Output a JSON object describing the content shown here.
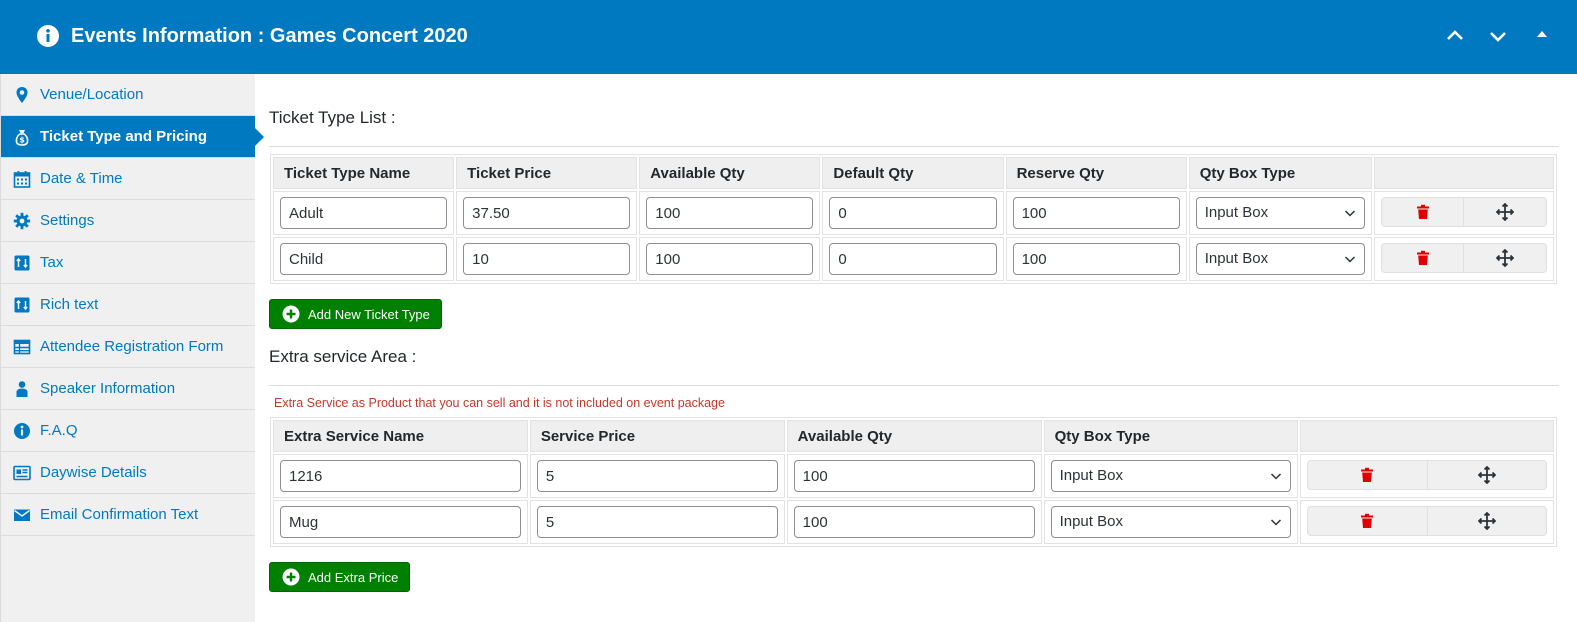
{
  "header": {
    "title": "Events Information : Games Concert 2020",
    "icon": "info-icon",
    "controls": [
      "chevron-up-icon",
      "chevron-down-icon",
      "collapse-triangle-icon"
    ]
  },
  "sidebar": {
    "items": [
      {
        "label": "Venue/Location",
        "icon": "map-pin-icon",
        "active": false
      },
      {
        "label": "Ticket Type and Pricing",
        "icon": "money-bag-icon",
        "active": true
      },
      {
        "label": "Date & Time",
        "icon": "calendar-icon",
        "active": false
      },
      {
        "label": "Settings",
        "icon": "gear-icon",
        "active": false
      },
      {
        "label": "Tax",
        "icon": "tax-icon",
        "active": false
      },
      {
        "label": "Rich text",
        "icon": "rich-text-icon",
        "active": false
      },
      {
        "label": "Attendee Registration Form",
        "icon": "form-table-icon",
        "active": false
      },
      {
        "label": "Speaker Information",
        "icon": "person-icon",
        "active": false
      },
      {
        "label": "F.A.Q",
        "icon": "info-icon",
        "active": false
      },
      {
        "label": "Daywise Details",
        "icon": "id-card-icon",
        "active": false
      },
      {
        "label": "Email Confirmation Text",
        "icon": "envelope-icon",
        "active": false
      }
    ]
  },
  "ticket_section": {
    "title": "Ticket Type List :",
    "headers": [
      "Ticket Type Name",
      "Ticket Price",
      "Available Qty",
      "Default Qty",
      "Reserve Qty",
      "Qty Box Type",
      ""
    ],
    "rows": [
      {
        "name": "Adult",
        "price": "37.50",
        "available": "100",
        "default": "0",
        "reserve": "100",
        "box_type": "Input Box"
      },
      {
        "name": "Child",
        "price": "10",
        "available": "100",
        "default": "0",
        "reserve": "100",
        "box_type": "Input Box"
      }
    ],
    "add_button": "Add New Ticket Type"
  },
  "extra_section": {
    "title": "Extra service Area :",
    "note": "Extra Service as Product that you can sell and it is not included on event package",
    "headers": [
      "Extra Service Name",
      "Service Price",
      "Available Qty",
      "Qty Box Type",
      ""
    ],
    "rows": [
      {
        "name": "1216",
        "price": "5",
        "available": "100",
        "box_type": "Input Box"
      },
      {
        "name": "Mug",
        "price": "5",
        "available": "100",
        "box_type": "Input Box"
      }
    ],
    "add_button": "Add Extra Price"
  },
  "colors": {
    "brand_blue": "#0079c0",
    "add_green": "#008000",
    "delete_red": "#e00000",
    "note_red": "#c0392b"
  }
}
